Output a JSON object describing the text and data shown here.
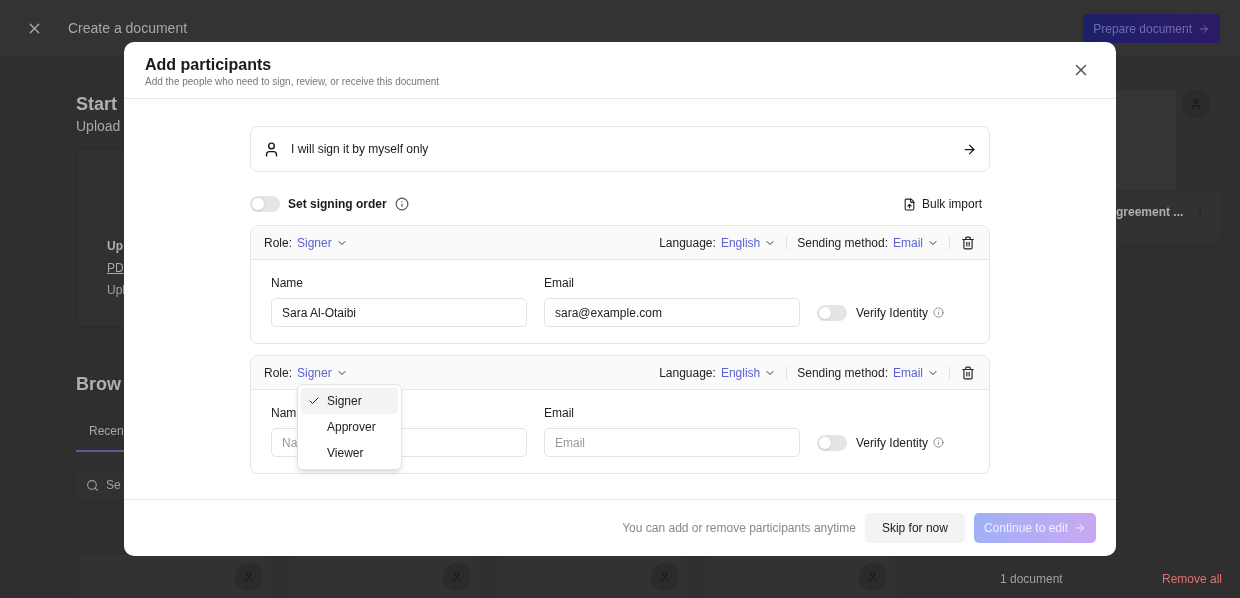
{
  "background": {
    "header_title": "Create a document",
    "prepare_button": "Prepare document",
    "heading": "Start",
    "subheading": "Upload",
    "upload_card": {
      "title": "Up",
      "link": "PD",
      "note": "Upl"
    },
    "section_heading": "Brow",
    "tab": "Recen",
    "search_placeholder": "Se",
    "document_card": {
      "title": "greement ..."
    },
    "document_count": "1 document",
    "remove_all": "Remove all"
  },
  "dialog": {
    "title": "Add participants",
    "subtitle": "Add the people who need to sign, review, or receive this document",
    "self_sign": "I will sign it by myself only",
    "signing_order": {
      "label": "Set signing order",
      "on": false
    },
    "bulk_import": "Bulk import",
    "participants": [
      {
        "role_label": "Role:",
        "role": "Signer",
        "language_label": "Language:",
        "language": "English",
        "sending_label": "Sending method:",
        "sending_method": "Email",
        "name_label": "Name",
        "name": "Sara Al-Otaibi",
        "email_label": "Email",
        "email": "sara@example.com",
        "verify_label": "Verify Identity",
        "verify": false
      },
      {
        "role_label": "Role:",
        "role": "Signer",
        "language_label": "Language:",
        "language": "English",
        "sending_label": "Sending method:",
        "sending_method": "Email",
        "name_label": "Nam",
        "name_placeholder": "Na",
        "email_label": "Email",
        "email_placeholder": "Email",
        "verify_label": "Verify Identity",
        "verify": false,
        "role_menu": [
          {
            "label": "Signer",
            "selected": true
          },
          {
            "label": "Approver",
            "selected": false
          },
          {
            "label": "Viewer",
            "selected": false
          }
        ]
      }
    ],
    "footer": {
      "note": "You can add or remove participants anytime",
      "skip": "Skip for now",
      "continue": "Continue to edit",
      "continue_disabled": true
    }
  }
}
